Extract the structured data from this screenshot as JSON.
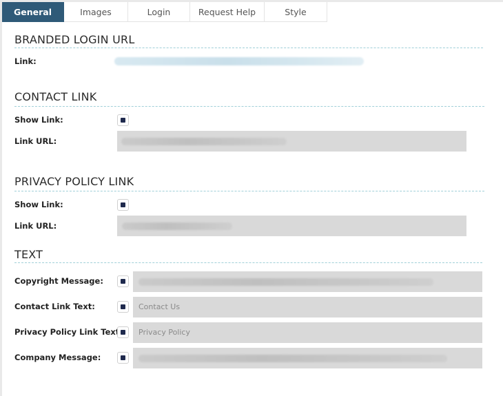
{
  "tabs": [
    {
      "label": "General",
      "active": true
    },
    {
      "label": "Images",
      "active": false
    },
    {
      "label": "Login",
      "active": false
    },
    {
      "label": "Request Help",
      "active": false
    },
    {
      "label": "Style",
      "active": false
    }
  ],
  "branded_login_url": {
    "title": "BRANDED LOGIN URL",
    "link_label": "Link:"
  },
  "contact_link": {
    "title": "CONTACT LINK",
    "show_link_label": "Show Link:",
    "show_link_checked": true,
    "link_url_label": "Link URL:"
  },
  "privacy_policy_link": {
    "title": "PRIVACY POLICY LINK",
    "show_link_label": "Show Link:",
    "show_link_checked": true,
    "link_url_label": "Link URL:"
  },
  "text_section": {
    "title": "TEXT",
    "rows": [
      {
        "label": "Copyright Message:",
        "checked": true,
        "value": ""
      },
      {
        "label": "Contact Link Text:",
        "checked": true,
        "value": "Contact Us"
      },
      {
        "label": "Privacy Policy Link Text:",
        "checked": true,
        "value": "Privacy Policy"
      },
      {
        "label": "Company Message:",
        "checked": true,
        "value": ""
      }
    ]
  },
  "colors": {
    "active_tab": "#2f5a78",
    "checkbox_fill": "#1f2a4d",
    "field_bg": "#d9d9d9",
    "divider": "#9fcfd8"
  }
}
